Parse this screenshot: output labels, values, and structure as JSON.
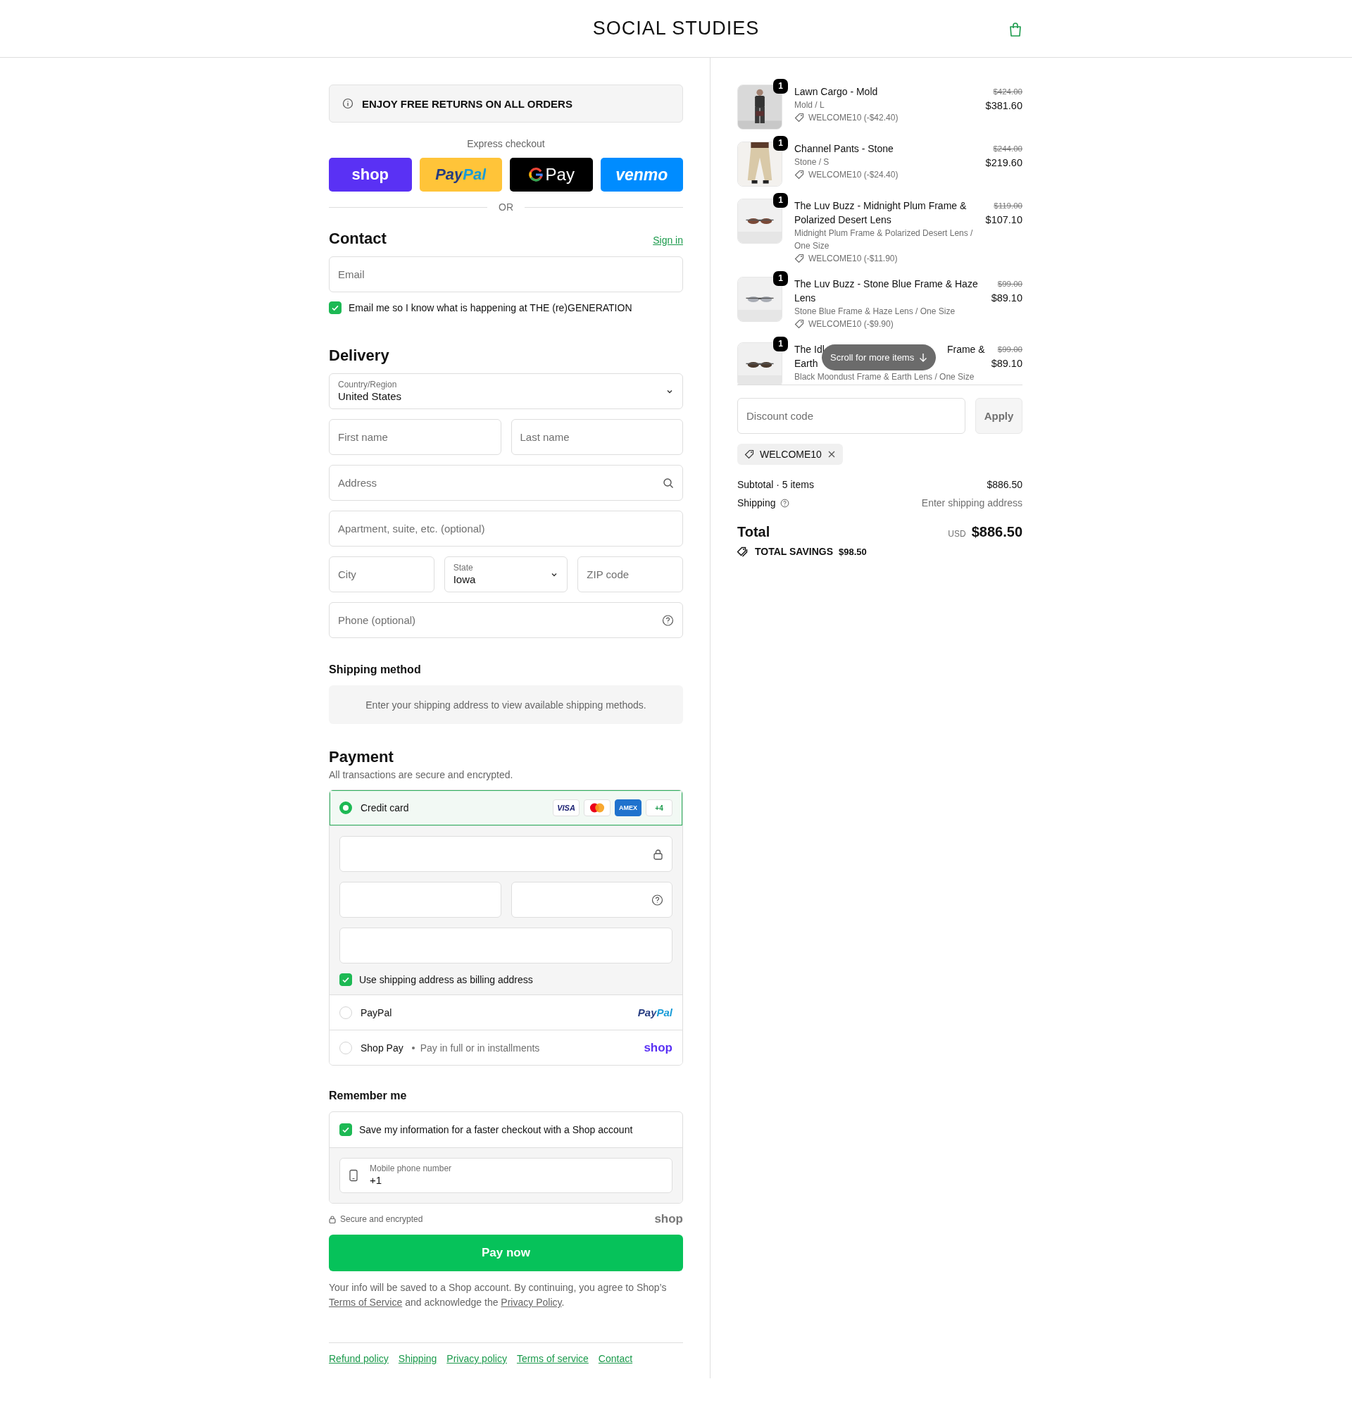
{
  "header": {
    "logo": "SOCIAL STUDIES"
  },
  "banner": {
    "text": "ENJOY FREE RETURNS ON ALL ORDERS"
  },
  "express": {
    "label": "Express checkout",
    "buttons": [
      {
        "kind": "shop",
        "label": "shop"
      },
      {
        "kind": "paypal",
        "label": "PayPal"
      },
      {
        "kind": "gpay",
        "label": "Pay"
      },
      {
        "kind": "venmo",
        "label": "venmo"
      }
    ],
    "separator": "OR"
  },
  "contact": {
    "title": "Contact",
    "link": "Sign in",
    "email": {
      "kind": "text",
      "placeholder": "Email"
    },
    "newsletter": {
      "label": "Email me so I know what is happening at THE (re)GENERATION",
      "checked": true
    }
  },
  "delivery": {
    "title": "Delivery",
    "rows": [
      [
        {
          "kind": "select",
          "label": "Country/Region",
          "value": "United States"
        }
      ],
      [
        {
          "kind": "text",
          "placeholder": "First name"
        },
        {
          "kind": "text",
          "placeholder": "Last name"
        }
      ],
      [
        {
          "kind": "search",
          "placeholder": "Address"
        }
      ],
      [
        {
          "kind": "text",
          "placeholder": "Apartment, suite, etc. (optional)"
        }
      ],
      [
        {
          "kind": "text",
          "placeholder": "City"
        },
        {
          "kind": "select",
          "label": "State",
          "value": "Iowa"
        },
        {
          "kind": "text",
          "placeholder": "ZIP code"
        }
      ],
      [
        {
          "kind": "help",
          "placeholder": "Phone (optional)"
        }
      ]
    ]
  },
  "shipping_method": {
    "title": "Shipping method",
    "message": "Enter your shipping address to view available shipping methods."
  },
  "payment": {
    "title": "Payment",
    "subtitle": "All transactions are secure and encrypted.",
    "methods": [
      {
        "kind": "card",
        "label": "Credit card",
        "selected": true,
        "brands": [
          {
            "kind": "visa",
            "label": "VISA"
          },
          {
            "kind": "mastercard"
          },
          {
            "kind": "amex",
            "label": "AMEX"
          },
          {
            "kind": "more",
            "label": "+4"
          }
        ],
        "fields": [
          [
            {
              "kind": "lock"
            }
          ],
          [
            {
              "kind": "text"
            },
            {
              "kind": "help"
            }
          ],
          [
            {
              "kind": "text"
            }
          ]
        ],
        "billing": {
          "label": "Use shipping address as billing address",
          "checked": true
        }
      },
      {
        "kind": "paypal",
        "label": "PayPal",
        "selected": false,
        "logo": "PayPal"
      },
      {
        "kind": "shoppay",
        "label": "Shop Pay",
        "note": "Pay in full or in installments",
        "selected": false,
        "logo": "shop"
      }
    ]
  },
  "remember": {
    "title": "Remember me",
    "save": {
      "label": "Save my information for a faster checkout with a Shop account",
      "checked": true
    },
    "phone": {
      "label": "Mobile phone number",
      "value": "+1"
    }
  },
  "secure": {
    "label": "Secure and encrypted",
    "logo": "shop"
  },
  "pay_button": "Pay now",
  "legal": [
    {
      "text": "Your info will be saved to a Shop account. By continuing, you agree to Shop’s "
    },
    {
      "link": "Terms of Service"
    },
    {
      "text": " and acknowledge the "
    },
    {
      "link": "Privacy Policy"
    },
    {
      "text": "."
    }
  ],
  "footer_links": [
    "Refund policy",
    "Shipping",
    "Privacy policy",
    "Terms of service",
    "Contact"
  ],
  "cart": {
    "items": [
      {
        "name": "Lawn Cargo - Mold",
        "variant": "Mold / L",
        "discount": "WELCOME10 (-$42.40)",
        "original_price": "$424.00",
        "price": "$381.60",
        "quantity": "1"
      },
      {
        "name": "Channel Pants - Stone",
        "variant": "Stone / S",
        "discount": "WELCOME10 (-$24.40)",
        "original_price": "$244.00",
        "price": "$219.60",
        "quantity": "1"
      },
      {
        "name": "The Luv Buzz - Midnight Plum Frame & Polarized Desert Lens",
        "variant": "Midnight Plum Frame & Polarized Desert Lens / One Size",
        "discount": "WELCOME10 (-$11.90)",
        "original_price": "$119.00",
        "price": "$107.10",
        "quantity": "1"
      },
      {
        "name": "The Luv Buzz - Stone Blue Frame & Haze Lens",
        "variant": "Stone Blue Frame & Haze Lens / One Size",
        "discount": "WELCOME10 (-$9.90)",
        "original_price": "$99.00",
        "price": "$89.10",
        "quantity": "1"
      },
      {
        "name_parts": [
          "The Idl",
          "Frame &",
          "Earth"
        ],
        "variant": "Black Moondust Frame & Earth Lens / One Size",
        "original_price": "$99.00",
        "price": "$89.10",
        "quantity": "1"
      }
    ],
    "scroll_hint": "Scroll for more items",
    "discount": {
      "placeholder": "Discount code",
      "button": "Apply",
      "applied": "WELCOME10"
    },
    "subtotal": {
      "label": "Subtotal · 5 items",
      "value": "$886.50"
    },
    "shipping": {
      "label": "Shipping",
      "value": "Enter shipping address"
    },
    "total": {
      "label": "Total",
      "currency": "USD",
      "value": "$886.50"
    },
    "savings": {
      "label": "TOTAL SAVINGS",
      "value": "$98.50"
    }
  }
}
